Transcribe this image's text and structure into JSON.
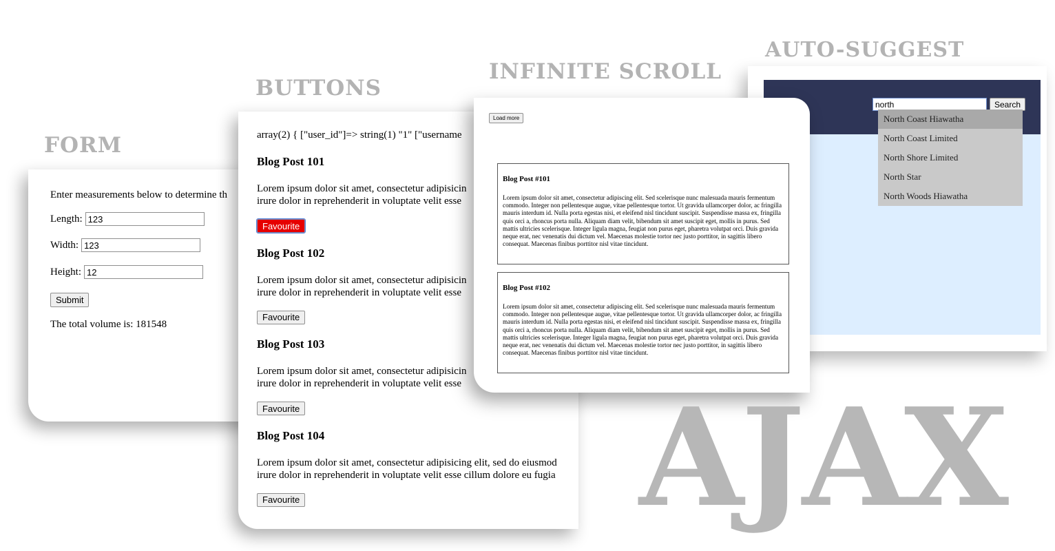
{
  "headings": {
    "form": "FORM",
    "buttons": "BUTTONS",
    "infinite_scroll": "INFINITE SCROLL",
    "auto_suggest": "AUTO-SUGGEST",
    "ajax": "AJAX"
  },
  "form": {
    "intro": "Enter measurements below to determine th",
    "length_label": "Length:",
    "length_value": "123",
    "width_label": "Width:",
    "width_value": "123",
    "height_label": "Height:",
    "height_value": "12",
    "submit_label": "Submit",
    "result": "The total volume is: 181548"
  },
  "buttons_panel": {
    "dump": "array(2) { [\"user_id\"]=> string(1) \"1\" [\"username",
    "posts": [
      {
        "title": "Blog Post 101",
        "line1": "Lorem ipsum dolor sit amet, consectetur adipisicin",
        "line2": "irure dolor in reprehenderit in voluptate velit esse",
        "button": "Favourite",
        "active": true
      },
      {
        "title": "Blog Post 102",
        "line1": "Lorem ipsum dolor sit amet, consectetur adipisicin",
        "line2": "irure dolor in reprehenderit in voluptate velit esse",
        "button": "Favourite",
        "active": false
      },
      {
        "title": "Blog Post 103",
        "line1": "Lorem ipsum dolor sit amet, consectetur adipisicin",
        "line2": "irure dolor in reprehenderit in voluptate velit esse",
        "button": "Favourite",
        "active": false
      },
      {
        "title": "Blog Post 104",
        "line1": "Lorem ipsum dolor sit amet, consectetur adipisicing elit, sed do eiusmod",
        "line2": "irure dolor in reprehenderit in voluptate velit esse cillum dolore eu fugia",
        "button": "Favourite",
        "active": false
      }
    ]
  },
  "infinite_scroll": {
    "load_more": "Load more",
    "posts": [
      {
        "title": "Blog Post #101",
        "body": "Lorem ipsum dolor sit amet, consectetur adipiscing elit. Sed scelerisque nunc malesuada mauris fermentum commodo. Integer non pellentesque augue, vitae pellentesque tortor. Ut gravida ullamcorper dolor, ac fringilla mauris interdum id. Nulla porta egestas nisi, et eleifend nisl tincidunt suscipit. Suspendisse massa ex, fringilla quis orci a, rhoncus porta nulla. Aliquam diam velit, bibendum sit amet suscipit eget, mollis in purus. Sed mattis ultricies scelerisque. Integer ligula magna, feugiat non purus eget, pharetra volutpat orci. Duis gravida neque erat, nec venenatis dui dictum vel. Maecenas molestie tortor nec justo porttitor, in sagittis libero consequat. Maecenas finibus porttitor nisl vitae tincidunt."
      },
      {
        "title": "Blog Post #102",
        "body": "Lorem ipsum dolor sit amet, consectetur adipiscing elit. Sed scelerisque nunc malesuada mauris fermentum commodo. Integer non pellentesque augue, vitae pellentesque tortor. Ut gravida ullamcorper dolor, ac fringilla mauris interdum id. Nulla porta egestas nisi, et eleifend nisl tincidunt suscipit. Suspendisse massa ex, fringilla quis orci a, rhoncus porta nulla. Aliquam diam velit, bibendum sit amet suscipit eget, mollis in purus. Sed mattis ultricies scelerisque. Integer ligula magna, feugiat non purus eget, pharetra volutpat orci. Duis gravida neque erat, nec venenatis dui dictum vel. Maecenas molestie tortor nec justo porttitor, in sagittis libero consequat. Maecenas finibus porttitor nisl vitae tincidunt."
      }
    ]
  },
  "auto_suggest": {
    "query": "north",
    "search_label": "Search",
    "suggestions": [
      "North Coast Hiawatha",
      "North Coast Limited",
      "North Shore Limited",
      "North Star",
      "North Woods Hiawatha"
    ],
    "highlighted": 0,
    "colors": {
      "header": "#2e3557",
      "body": "#ddeeff",
      "dropdown": "#c9c9c9",
      "highlight": "#a9a9a9"
    }
  }
}
